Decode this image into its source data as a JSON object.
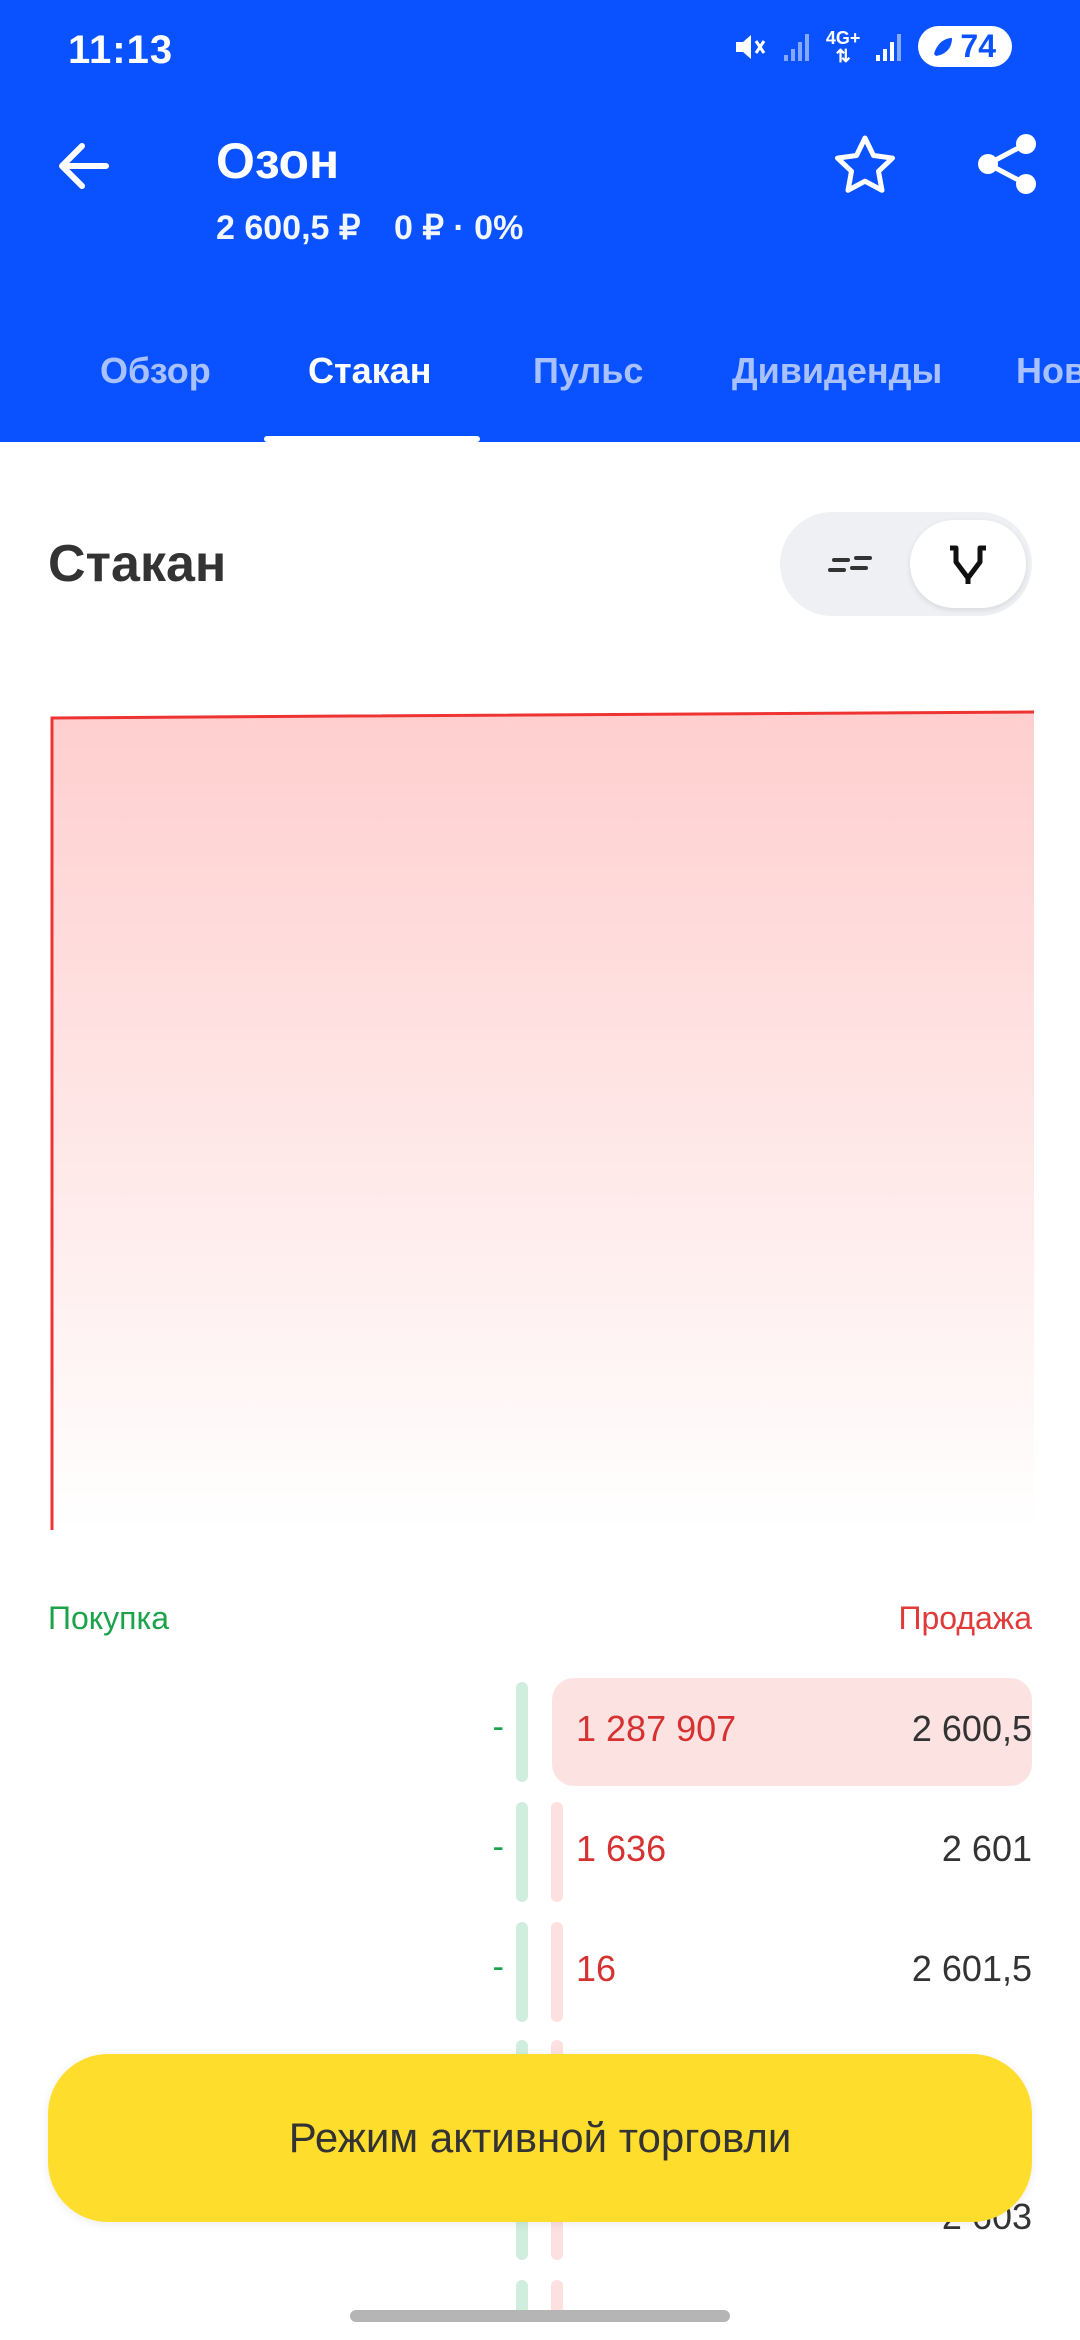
{
  "status_bar": {
    "time": "11:13",
    "network": "4G+",
    "battery": "74"
  },
  "header": {
    "title": "Озон",
    "price": "2 600,5 ₽",
    "change": "0 ₽ · 0%"
  },
  "tabs": [
    {
      "label": "Обзор"
    },
    {
      "label": "Стакан"
    },
    {
      "label": "Пульс"
    },
    {
      "label": "Дивиденды"
    },
    {
      "label": "Нов"
    }
  ],
  "section": {
    "title": "Стакан"
  },
  "order_book": {
    "buy_label": "Покупка",
    "sell_label": "Продажа",
    "rows": [
      {
        "bid": "-",
        "ask_qty": "1 287 907",
        "price": "2 600,5"
      },
      {
        "bid": "-",
        "ask_qty": "1 636",
        "price": "2 601"
      },
      {
        "bid": "-",
        "ask_qty": "16",
        "price": "2 601,5"
      }
    ],
    "partial_price": "2 603"
  },
  "cta": {
    "label": "Режим активной торговли"
  },
  "colors": {
    "header_blue": "#0a52ff",
    "buy_green": "#1aa34a",
    "sell_red": "#d63232",
    "cta_yellow": "#ffdd2d"
  }
}
